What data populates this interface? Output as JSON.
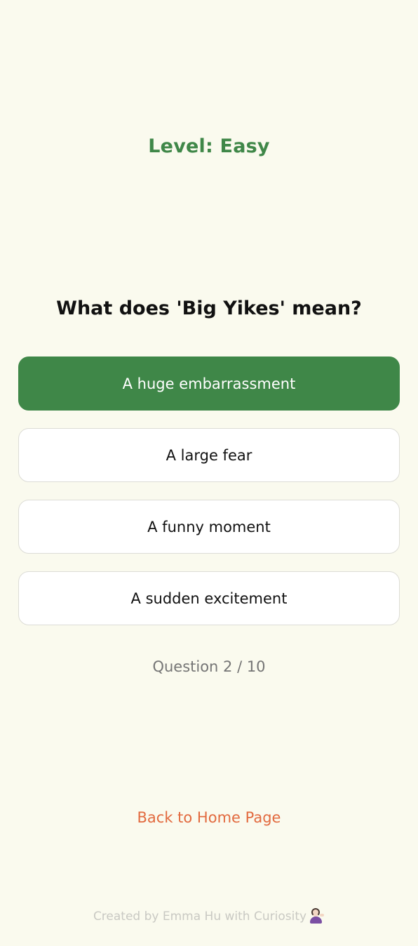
{
  "quiz": {
    "level_text": "Level: Easy",
    "question": "What does 'Big Yikes' mean?",
    "options": [
      {
        "label": "A huge embarrassment",
        "selected": true
      },
      {
        "label": "A large fear",
        "selected": false
      },
      {
        "label": "A funny moment",
        "selected": false
      },
      {
        "label": "A sudden excitement",
        "selected": false
      }
    ],
    "progress_text": "Question 2 / 10"
  },
  "nav": {
    "back_label": "Back to Home Page"
  },
  "footer": {
    "credit": "Created by Emma Hu with Curiosity",
    "emoji_icon": "woman-tipping-hand-icon"
  },
  "colors": {
    "background": "#fafaee",
    "accent_green": "#3f8748",
    "link_orange": "#e26a3f"
  }
}
